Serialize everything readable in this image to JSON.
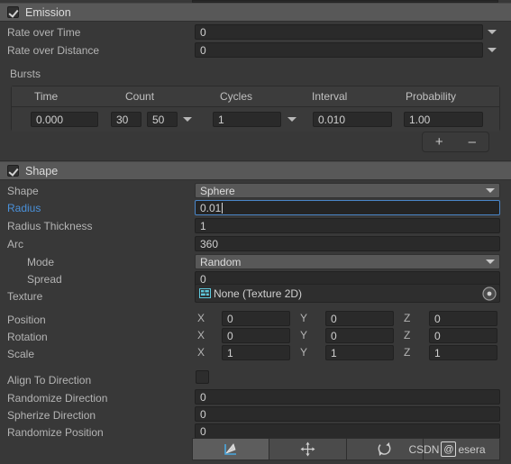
{
  "emission": {
    "title": "Emission",
    "enabled": true,
    "rows": [
      {
        "label": "Rate over Time",
        "value": "0",
        "has_dropdown": true
      },
      {
        "label": "Rate over Distance",
        "value": "0",
        "has_dropdown": true
      }
    ],
    "bursts_label": "Bursts",
    "bursts": {
      "columns": [
        "Time",
        "Count",
        "Cycles",
        "Interval",
        "Probability"
      ],
      "rows": [
        {
          "time": "0.000",
          "count": "30",
          "count_max": "50",
          "cycles": "1",
          "interval": "0.010",
          "probability": "1.00"
        }
      ],
      "add_label": "+",
      "remove_label": "–"
    }
  },
  "shape": {
    "title": "Shape",
    "enabled": true,
    "shape_label": "Shape",
    "shape_value": "Sphere",
    "radius_label": "Radius",
    "radius_value": "0.01",
    "radius_thickness_label": "Radius Thickness",
    "radius_thickness_value": "1",
    "arc_label": "Arc",
    "arc_value": "360",
    "mode_label": "Mode",
    "mode_value": "Random",
    "spread_label": "Spread",
    "spread_value": "0",
    "texture_label": "Texture",
    "texture_value": "None (Texture 2D)",
    "transform": {
      "axis_labels": [
        "X",
        "Y",
        "Z"
      ],
      "rows": [
        {
          "label": "Position",
          "values": [
            "0",
            "0",
            "0"
          ]
        },
        {
          "label": "Rotation",
          "values": [
            "0",
            "0",
            "0"
          ]
        },
        {
          "label": "Scale",
          "values": [
            "1",
            "1",
            "1"
          ]
        }
      ]
    },
    "align_to_direction_label": "Align To Direction",
    "align_to_direction_checked": false,
    "randomize_direction_label": "Randomize Direction",
    "randomize_direction_value": "0",
    "spherize_direction_label": "Spherize Direction",
    "spherize_direction_value": "0",
    "randomize_position_label": "Randomize Position",
    "randomize_position_value": "0"
  },
  "toolbar": {
    "buttons": [
      "shape-gizmo-icon",
      "move-gizmo-icon",
      "rotate-gizmo-icon",
      "watermark-slot"
    ]
  },
  "watermark": {
    "text_left": "CSDN",
    "logo": "@",
    "text_right": "esera"
  },
  "colors": {
    "accent": "#4a90d9",
    "header_bg": "#585858",
    "panel_bg": "#383838",
    "field_bg": "#2a2a2a"
  }
}
